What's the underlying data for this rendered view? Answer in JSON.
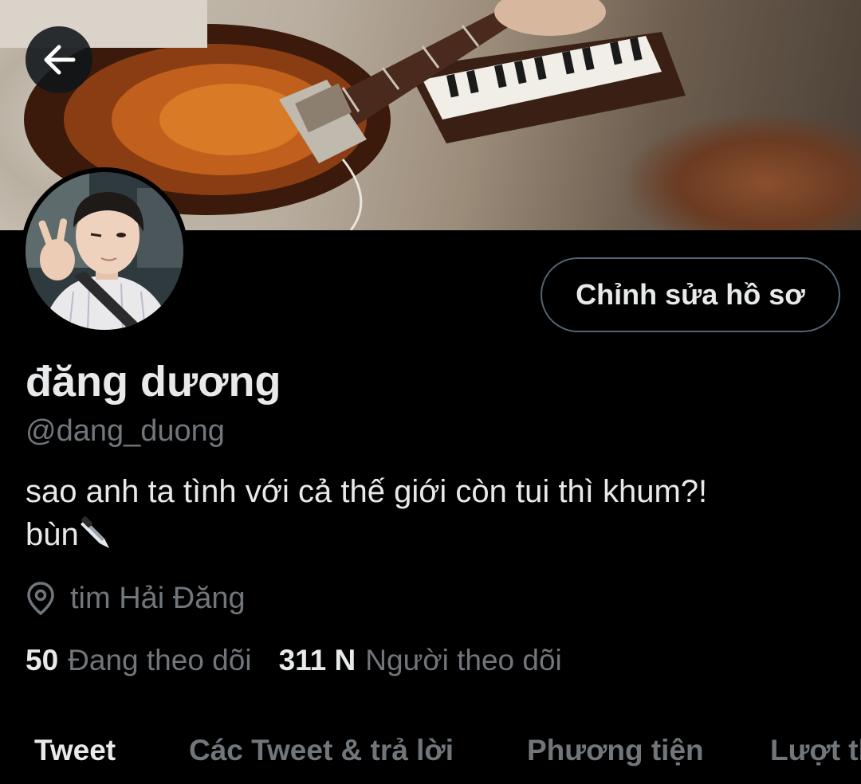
{
  "header": {
    "back_button": "back-arrow-icon"
  },
  "profile": {
    "display_name": "đăng dương",
    "handle": "@dang_duong",
    "bio_line1": "sao anh ta tình với cả thế giới còn tui thì khum?!",
    "bio_line2": "bùn",
    "location": "tim Hải Đăng",
    "edit_button": "Chỉnh sửa hồ sơ"
  },
  "stats": {
    "following_count": "50",
    "following_label": "Đang theo dõi",
    "followers_count": "311 N",
    "followers_label": "Người theo dõi"
  },
  "tabs": [
    {
      "label": "Tweet"
    },
    {
      "label": "Các Tweet & trả lời"
    },
    {
      "label": "Phương tiện"
    },
    {
      "label": "Lượt thích"
    }
  ],
  "colors": {
    "background": "#000000",
    "primary_text": "#e7e9ea",
    "secondary_text": "#71767b",
    "border": "#536471"
  }
}
